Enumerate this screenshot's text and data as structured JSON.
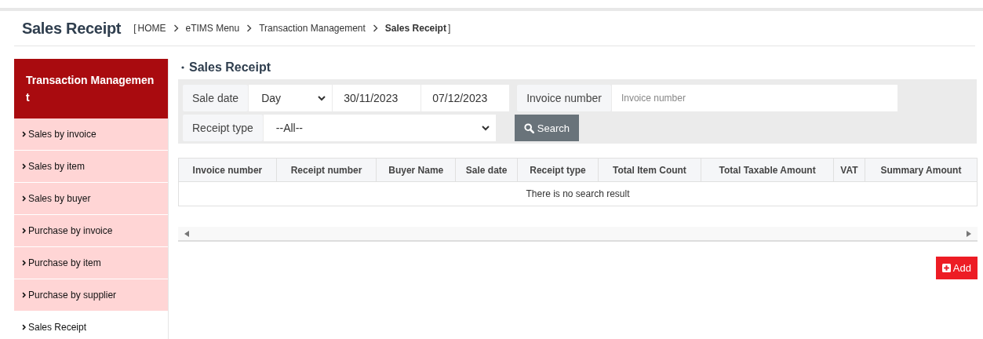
{
  "page_title": "Sales Receipt",
  "breadcrumb": {
    "open": "[",
    "items": [
      "HOME",
      "eTIMS Menu",
      "Transaction Management",
      "Sales Receipt"
    ],
    "close": "]"
  },
  "sidebar": {
    "title": "Transaction Management",
    "items": [
      {
        "label": "Sales by invoice",
        "selected": false
      },
      {
        "label": "Sales by item",
        "selected": false
      },
      {
        "label": "Sales by buyer",
        "selected": false
      },
      {
        "label": "Purchase by invoice",
        "selected": false
      },
      {
        "label": "Purchase by item",
        "selected": false
      },
      {
        "label": "Purchase by supplier",
        "selected": false
      },
      {
        "label": "Sales Receipt",
        "selected": true
      }
    ]
  },
  "section_title": "Sales Receipt",
  "filters": {
    "sale_date": {
      "label": "Sale date",
      "period": "Day",
      "from": "30/11/2023",
      "to": "07/12/2023"
    },
    "invoice_number": {
      "label": "Invoice number",
      "placeholder": "Invoice number"
    },
    "receipt_type": {
      "label": "Receipt type",
      "value": "--All--"
    },
    "search_button": "Search"
  },
  "table": {
    "columns": [
      "Invoice number",
      "Receipt number",
      "Buyer Name",
      "Sale date",
      "Receipt type",
      "Total Item Count",
      "Total Taxable Amount",
      "VAT",
      "Summary Amount"
    ],
    "empty_message": "There is no search result"
  },
  "add_button": "Add"
}
